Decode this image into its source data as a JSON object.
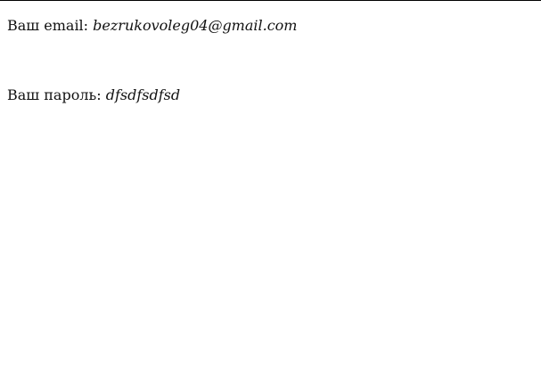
{
  "email": {
    "label": "Ваш email:",
    "value": "bezrukovoleg04@gmail.com"
  },
  "password": {
    "label": "Ваш пароль:",
    "value": "dfsdfsdfsd"
  }
}
